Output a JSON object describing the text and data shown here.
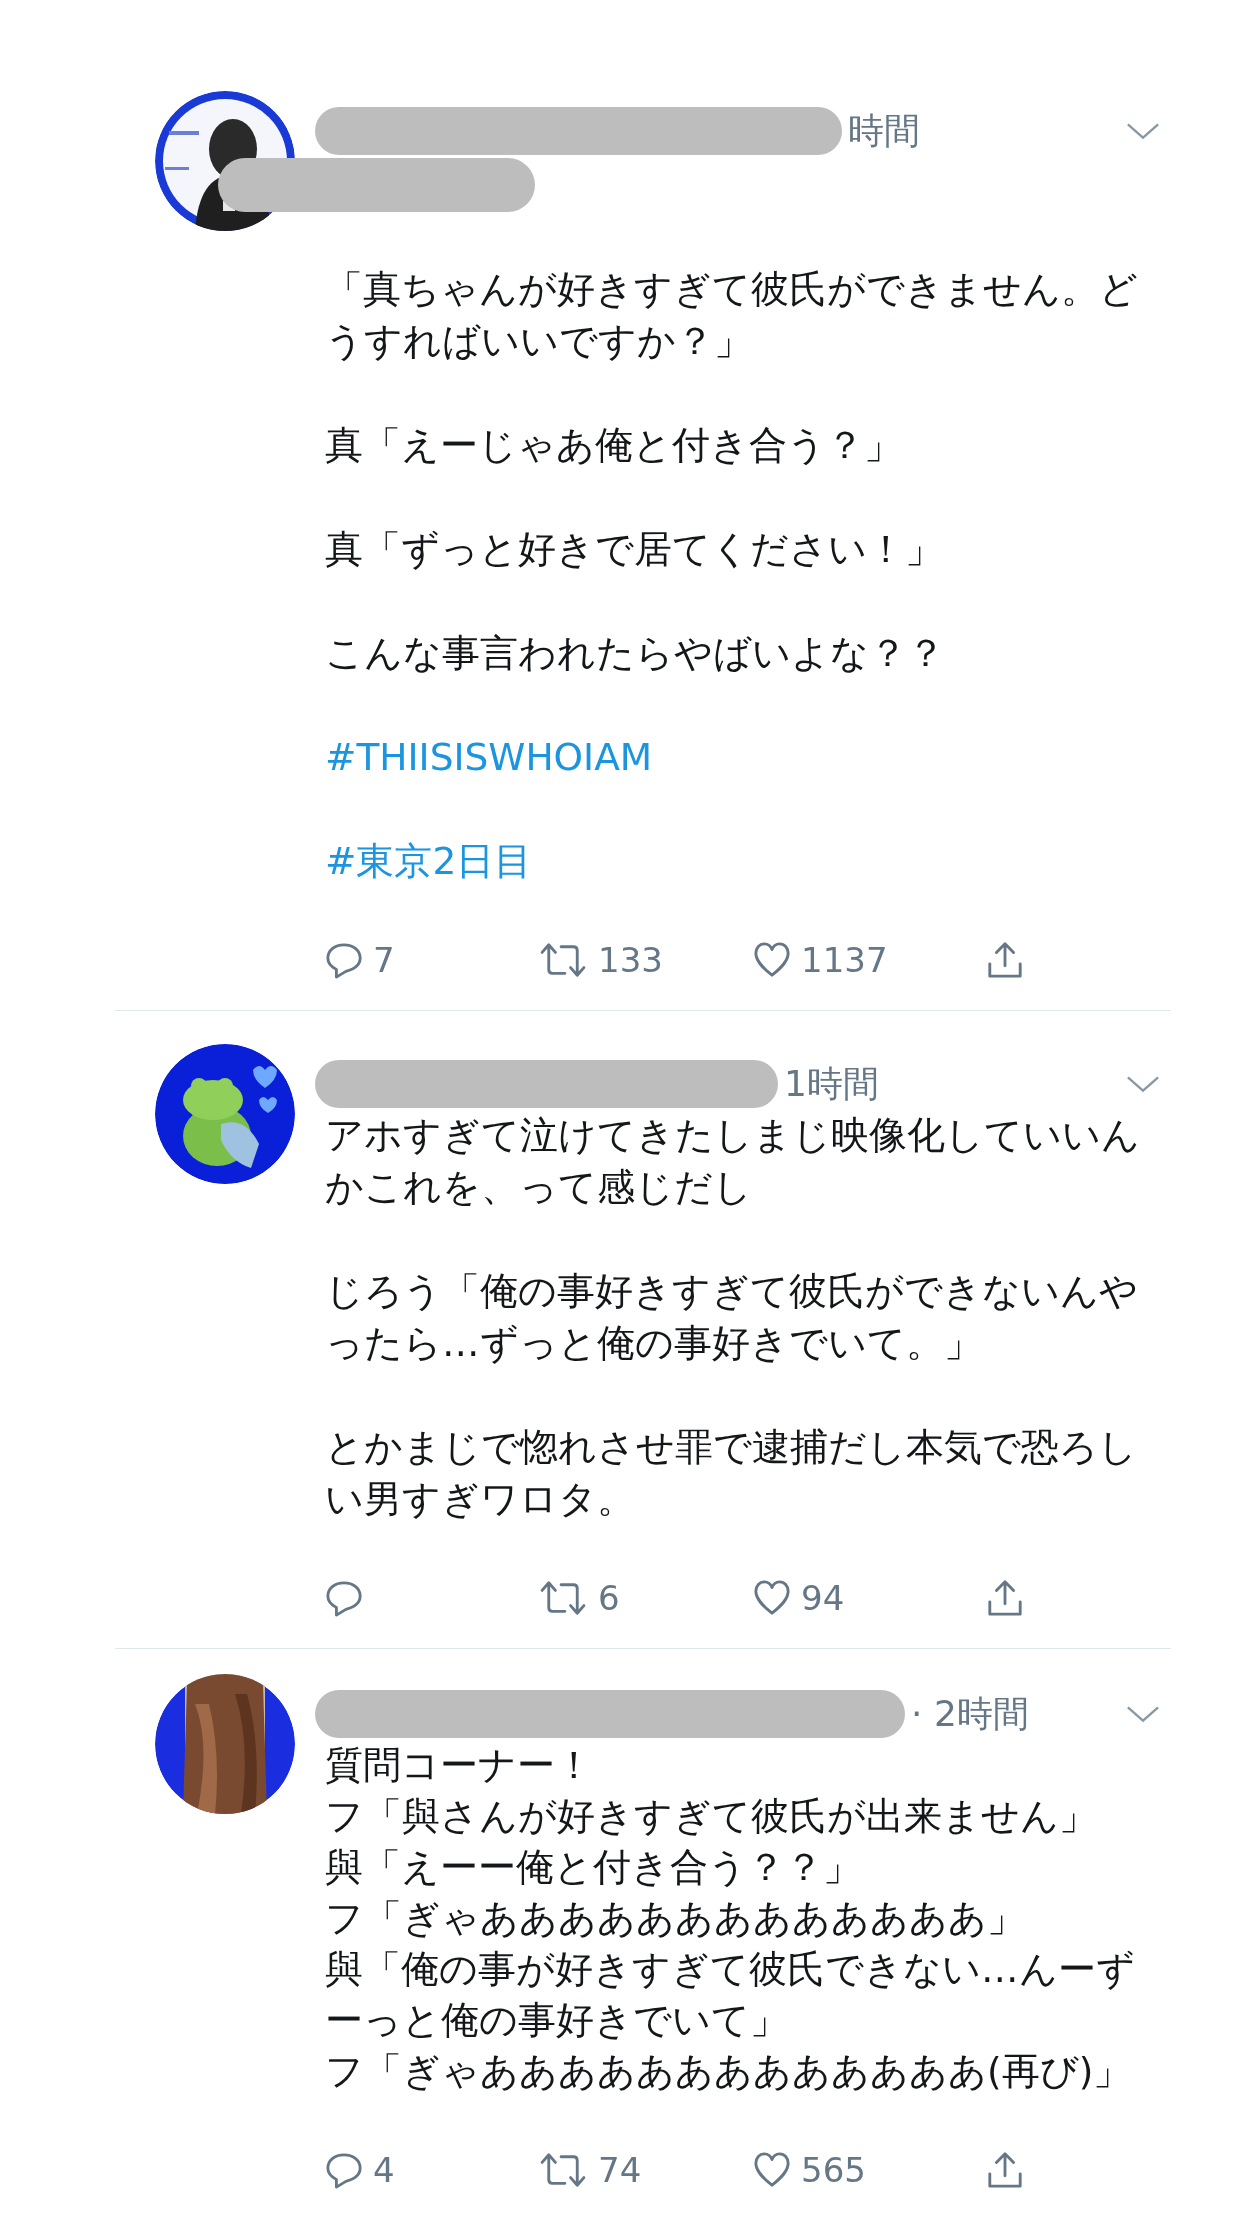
{
  "tweets": [
    {
      "time": "時間",
      "paragraphs": [
        {
          "kind": "text",
          "text": "「真ちゃんが好きすぎて彼氏ができません。どうすればいいですか？」"
        },
        {
          "kind": "text",
          "text": "真「えーじゃあ俺と付き合う？」"
        },
        {
          "kind": "text",
          "text": "真「ずっと好きで居てください！」"
        },
        {
          "kind": "text",
          "text": "こんな事言われたらやばいよな？？"
        },
        {
          "kind": "hashtag",
          "text": "#THIISISWHOIAM"
        },
        {
          "kind": "hashtag",
          "text": "#東京2日目"
        }
      ],
      "replies": "7",
      "retweets": "133",
      "likes": "1137"
    },
    {
      "time": "1時間",
      "paragraphs": [
        {
          "kind": "text",
          "text": "アホすぎて泣けてきたしまじ映像化していいんかこれを、って感じだし"
        },
        {
          "kind": "text",
          "text": "じろう「俺の事好きすぎて彼氏ができないんやったら…ずっと俺の事好きでいて。」"
        },
        {
          "kind": "text",
          "text": "とかまじで惚れさせ罪で逮捕だし本気で恐ろしい男すぎワロタ。"
        }
      ],
      "retweets": "6",
      "likes": "94"
    },
    {
      "time": "· 2時間",
      "paragraphs": [
        {
          "kind": "text",
          "text": "質問コーナー！"
        },
        {
          "kind": "line",
          "text": "フ「與さんが好きすぎて彼氏が出来ません」"
        },
        {
          "kind": "line",
          "text": "與「えーー俺と付き合う？？」"
        },
        {
          "kind": "line",
          "text": "フ「ぎゃあああああああああああああ」"
        },
        {
          "kind": "line",
          "text": "與「俺の事が好きすぎて彼氏できない…んーずーっと俺の事好きでいて」"
        },
        {
          "kind": "line",
          "text": "フ「ぎゃあああああああああああああ(再び)」"
        }
      ],
      "replies": "4",
      "retweets": "74",
      "likes": "565"
    }
  ]
}
